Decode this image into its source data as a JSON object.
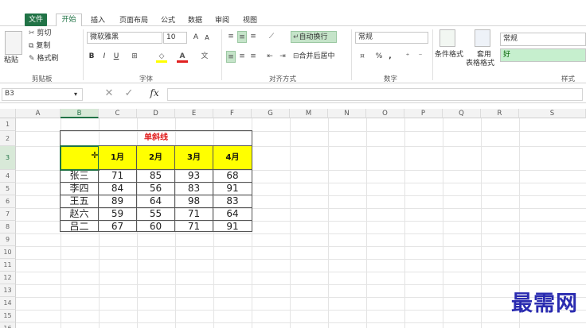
{
  "tabs": [
    "文件",
    "开始",
    "插入",
    "页面布局",
    "公式",
    "数据",
    "审阅",
    "视图"
  ],
  "ribbon": {
    "clipboard": {
      "paste": "粘贴",
      "cut": "剪切",
      "copy": "复制",
      "format_painter": "格式刷",
      "group": "剪贴板"
    },
    "font": {
      "name": "微软雅黑",
      "size": "10",
      "bold": "B",
      "italic": "I",
      "underline": "U",
      "group": "字体",
      "grow": "A",
      "shrink": "A"
    },
    "alignment": {
      "wrap": "自动换行",
      "merge": "合并后居中",
      "group": "对齐方式"
    },
    "number": {
      "format": "常规",
      "percent": "%",
      "comma": ",",
      "group": "数字"
    },
    "styles": {
      "conditional": "条件格式",
      "table": "套用",
      "table2": "表格格式",
      "style_normal": "常规",
      "style_good": "好",
      "group": "样式"
    }
  },
  "formula_bar": {
    "name_box": "B3",
    "fx": "fx",
    "value": ""
  },
  "columns": [
    "A",
    "B",
    "C",
    "D",
    "E",
    "F",
    "G",
    "M",
    "N",
    "O",
    "P",
    "Q",
    "R",
    "S"
  ],
  "rows": [
    "1",
    "2",
    "3",
    "4",
    "5",
    "6",
    "7",
    "8",
    "9",
    "10",
    "11",
    "12",
    "13",
    "14",
    "15",
    "16"
  ],
  "table": {
    "title": "单斜线",
    "headers": [
      "1月",
      "2月",
      "3月",
      "4月"
    ],
    "names": [
      "张三",
      "李四",
      "王五",
      "赵六",
      "吕二"
    ],
    "values": [
      [
        "71",
        "85",
        "93",
        "68"
      ],
      [
        "84",
        "56",
        "83",
        "91"
      ],
      [
        "89",
        "64",
        "98",
        "83"
      ],
      [
        "59",
        "55",
        "71",
        "64"
      ],
      [
        "67",
        "60",
        "71",
        "91"
      ]
    ]
  },
  "watermark": "最需网",
  "colors": {
    "accent": "#217346",
    "header_fill": "#ffff00",
    "title": "#e02020"
  }
}
